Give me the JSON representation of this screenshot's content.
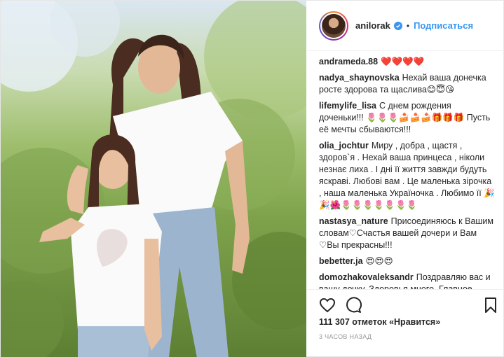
{
  "post": {
    "username": "anilorak",
    "separator": "•",
    "follow_label": "Подписаться",
    "accent_color": "#3897f0",
    "likes_text": "111 307 отметок «Нравится»",
    "time_text": "3 часов назад"
  },
  "comments": [
    {
      "author": "andrameda.88",
      "text": "❤️❤️❤️❤️"
    },
    {
      "author": "nadya_shaynovska",
      "text": "Нехай ваша донечка росте здорова та щаслива😊😇😘"
    },
    {
      "author": "lifemylife_lisa",
      "text": "С днем рождения доченьки!!! 🌷🌷🌷🍰🍰🍰🎁🎁🎁 Пусть её мечты сбываются!!!"
    },
    {
      "author": "olia_jochtur",
      "text": "Миру , добра , щастя , здоров`я . Нехай ваша принцеса , ніколи незнає лиха . І дні її життя завжди будуть яскраві. Любові вам . Це маленька зірочка , наша маленька Україночка . Любимо її 🎉🎉🌺🌷🌷🌷🌷🌷🌷🌷"
    },
    {
      "author": "nastasya_nature",
      "text": "Присоединяюсь к Вашим словам♡Счастья вашей дочери и Вам ♡Вы прекрасны!!!"
    },
    {
      "author": "bebetter.ja",
      "text": "😍😍😍"
    },
    {
      "author": "domozhakovaleksandr",
      "text": "Поздравляю вас и вашу дочку. Здоровья много. Главное здоровья."
    }
  ],
  "icons": [
    "verified-badge-icon",
    "heart-icon",
    "comment-icon",
    "bookmark-icon"
  ]
}
